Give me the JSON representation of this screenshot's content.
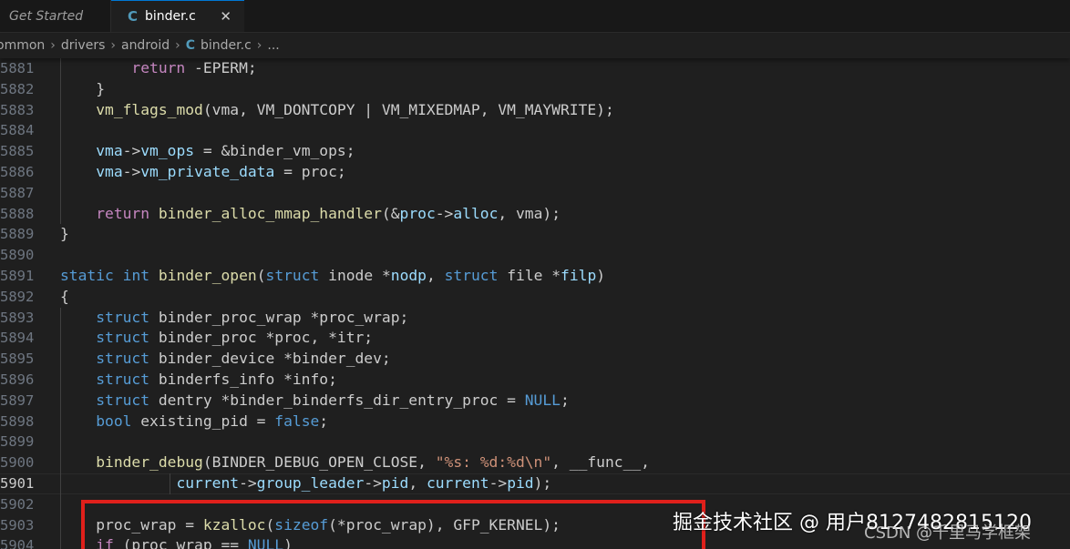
{
  "tabs": [
    {
      "label": "Get Started",
      "active": false
    },
    {
      "label": "binder.c",
      "active": true,
      "icon": "c-file-icon"
    }
  ],
  "tab_close_glyph": "✕",
  "file_icon_letter": "C",
  "breadcrumb": {
    "items": [
      "ommon",
      "drivers",
      "android"
    ],
    "file": "binder.c",
    "ellipsis": "..."
  },
  "editor": {
    "current_line": "5901",
    "lines": [
      {
        "n": "5881",
        "tokens": [
          {
            "t": "        ",
            "c": "plain"
          },
          {
            "t": "return",
            "c": "ctl"
          },
          {
            "t": " -EPERM;",
            "c": "plain"
          }
        ]
      },
      {
        "n": "5882",
        "tokens": [
          {
            "t": "    }",
            "c": "plain"
          }
        ]
      },
      {
        "n": "5883",
        "tokens": [
          {
            "t": "    ",
            "c": "plain"
          },
          {
            "t": "vm_flags_mod",
            "c": "fn"
          },
          {
            "t": "(vma, VM_DONTCOPY | VM_MIXEDMAP, VM_MAYWRITE);",
            "c": "plain"
          }
        ]
      },
      {
        "n": "5884",
        "tokens": []
      },
      {
        "n": "5885",
        "tokens": [
          {
            "t": "    ",
            "c": "plain"
          },
          {
            "t": "vma",
            "c": "var"
          },
          {
            "t": "->",
            "c": "plain"
          },
          {
            "t": "vm_ops",
            "c": "var"
          },
          {
            "t": " = &binder_vm_ops;",
            "c": "plain"
          }
        ]
      },
      {
        "n": "5886",
        "tokens": [
          {
            "t": "    ",
            "c": "plain"
          },
          {
            "t": "vma",
            "c": "var"
          },
          {
            "t": "->",
            "c": "plain"
          },
          {
            "t": "vm_private_data",
            "c": "var"
          },
          {
            "t": " = proc;",
            "c": "plain"
          }
        ]
      },
      {
        "n": "5887",
        "tokens": []
      },
      {
        "n": "5888",
        "tokens": [
          {
            "t": "    ",
            "c": "plain"
          },
          {
            "t": "return",
            "c": "ctl"
          },
          {
            "t": " ",
            "c": "plain"
          },
          {
            "t": "binder_alloc_mmap_handler",
            "c": "fn"
          },
          {
            "t": "(&",
            "c": "plain"
          },
          {
            "t": "proc",
            "c": "var"
          },
          {
            "t": "->",
            "c": "plain"
          },
          {
            "t": "alloc",
            "c": "var"
          },
          {
            "t": ", vma);",
            "c": "plain"
          }
        ]
      },
      {
        "n": "5889",
        "tokens": [
          {
            "t": "}",
            "c": "plain"
          }
        ]
      },
      {
        "n": "5890",
        "tokens": []
      },
      {
        "n": "5891",
        "tokens": [
          {
            "t": "static",
            "c": "kw"
          },
          {
            "t": " ",
            "c": "plain"
          },
          {
            "t": "int",
            "c": "kw"
          },
          {
            "t": " ",
            "c": "plain"
          },
          {
            "t": "binder_open",
            "c": "fn"
          },
          {
            "t": "(",
            "c": "plain"
          },
          {
            "t": "struct",
            "c": "kw"
          },
          {
            "t": " inode *",
            "c": "plain"
          },
          {
            "t": "nodp",
            "c": "var"
          },
          {
            "t": ", ",
            "c": "plain"
          },
          {
            "t": "struct",
            "c": "kw"
          },
          {
            "t": " file *",
            "c": "plain"
          },
          {
            "t": "filp",
            "c": "var"
          },
          {
            "t": ")",
            "c": "plain"
          }
        ]
      },
      {
        "n": "5892",
        "tokens": [
          {
            "t": "{",
            "c": "plain"
          }
        ]
      },
      {
        "n": "5893",
        "tokens": [
          {
            "t": "    ",
            "c": "plain"
          },
          {
            "t": "struct",
            "c": "kw"
          },
          {
            "t": " binder_proc_wrap *proc_wrap;",
            "c": "plain"
          }
        ]
      },
      {
        "n": "5894",
        "tokens": [
          {
            "t": "    ",
            "c": "plain"
          },
          {
            "t": "struct",
            "c": "kw"
          },
          {
            "t": " binder_proc *proc, *itr;",
            "c": "plain"
          }
        ]
      },
      {
        "n": "5895",
        "tokens": [
          {
            "t": "    ",
            "c": "plain"
          },
          {
            "t": "struct",
            "c": "kw"
          },
          {
            "t": " binder_device *binder_dev;",
            "c": "plain"
          }
        ]
      },
      {
        "n": "5896",
        "tokens": [
          {
            "t": "    ",
            "c": "plain"
          },
          {
            "t": "struct",
            "c": "kw"
          },
          {
            "t": " binderfs_info *info;",
            "c": "plain"
          }
        ]
      },
      {
        "n": "5897",
        "tokens": [
          {
            "t": "    ",
            "c": "plain"
          },
          {
            "t": "struct",
            "c": "kw"
          },
          {
            "t": " dentry *binder_binderfs_dir_entry_proc = ",
            "c": "plain"
          },
          {
            "t": "NULL",
            "c": "mac"
          },
          {
            "t": ";",
            "c": "plain"
          }
        ]
      },
      {
        "n": "5898",
        "tokens": [
          {
            "t": "    ",
            "c": "plain"
          },
          {
            "t": "bool",
            "c": "kw"
          },
          {
            "t": " existing_pid = ",
            "c": "plain"
          },
          {
            "t": "false",
            "c": "kw"
          },
          {
            "t": ";",
            "c": "plain"
          }
        ]
      },
      {
        "n": "5899",
        "tokens": []
      },
      {
        "n": "5900",
        "tokens": [
          {
            "t": "    ",
            "c": "plain"
          },
          {
            "t": "binder_debug",
            "c": "fn"
          },
          {
            "t": "(BINDER_DEBUG_OPEN_CLOSE, ",
            "c": "plain"
          },
          {
            "t": "\"%s: %d:%d\\n\"",
            "c": "str"
          },
          {
            "t": ", __func__,",
            "c": "plain"
          }
        ]
      },
      {
        "n": "5901",
        "tokens": [
          {
            "t": "             ",
            "c": "plain"
          },
          {
            "t": "current",
            "c": "var"
          },
          {
            "t": "->",
            "c": "plain"
          },
          {
            "t": "group_leader",
            "c": "var"
          },
          {
            "t": "->",
            "c": "plain"
          },
          {
            "t": "pid",
            "c": "var"
          },
          {
            "t": ", ",
            "c": "plain"
          },
          {
            "t": "current",
            "c": "var"
          },
          {
            "t": "->",
            "c": "plain"
          },
          {
            "t": "pid",
            "c": "var"
          },
          {
            "t": ");",
            "c": "plain"
          }
        ]
      },
      {
        "n": "5902",
        "tokens": []
      },
      {
        "n": "5903",
        "tokens": [
          {
            "t": "    proc_wrap = ",
            "c": "plain"
          },
          {
            "t": "kzalloc",
            "c": "fn"
          },
          {
            "t": "(",
            "c": "plain"
          },
          {
            "t": "sizeof",
            "c": "kw"
          },
          {
            "t": "(*proc_wrap), GFP_KERNEL);",
            "c": "plain"
          }
        ]
      },
      {
        "n": "5904",
        "tokens": [
          {
            "t": "    ",
            "c": "plain"
          },
          {
            "t": "if",
            "c": "ctl"
          },
          {
            "t": " (proc_wrap == ",
            "c": "plain"
          },
          {
            "t": "NULL",
            "c": "mac"
          },
          {
            "t": ")",
            "c": "plain"
          }
        ]
      }
    ]
  },
  "watermark": {
    "line1": "掘金技术社区 @ 用户8127482815120",
    "line2": "CSDN @千里马学框架"
  }
}
